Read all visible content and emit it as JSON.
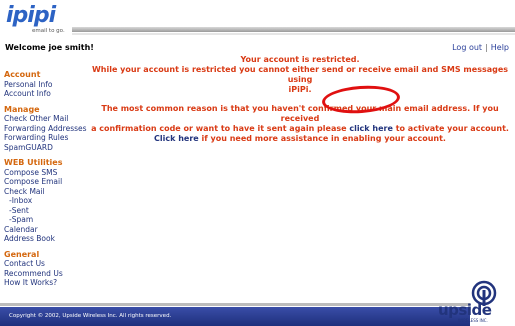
{
  "header": {
    "logo_text": "ipipi",
    "logo_tagline": "email to go.",
    "welcome": "Welcome joe smith!",
    "logout_label": "Log out",
    "separator": "|",
    "help_label": "Help"
  },
  "sidebar": {
    "account_title": "Account",
    "account_items": [
      "Personal Info",
      "Account Info"
    ],
    "manage_title": "Manage",
    "manage_items": [
      "Check Other Mail",
      "Forwarding Addresses",
      "Forwarding Rules",
      "SpamGUARD"
    ],
    "web_title": "WEB Utilities",
    "web_items": [
      "Compose SMS",
      "Compose Email",
      "Check Mail",
      "-Inbox",
      "-Sent",
      "-Spam",
      "Calendar",
      "Address Book"
    ],
    "general_title": "General",
    "general_items": [
      "Contact Us",
      "Recommend Us",
      "How It Works?"
    ]
  },
  "message": {
    "line1": "Your account is restricted.",
    "line2": "While your account is restricted you cannot either send or receive email and SMS messages using",
    "line2b": "iPiPi.",
    "line3a": "The most common reason is that you haven't confirmed your main email address. If you received",
    "line3b_pre": "a confirmation code or want to have it sent again please",
    "click_here_1": "click here",
    "line3b_post": "to activate your account.",
    "click_here_2": "Click here",
    "line4_post": "if you need more assistance in enabling your account."
  },
  "footer": {
    "copyright": "Copyright © 2002, Upside Wireless Inc. All rights reserved.",
    "brand": "upside",
    "brand_sub": "WIRELESS INC."
  },
  "colors": {
    "accent_orange": "#d4670e",
    "link_blue": "#22347d",
    "warning_red": "#d93a14",
    "footer_blue": "#2a3f9a",
    "annotation_red": "#e01010"
  }
}
